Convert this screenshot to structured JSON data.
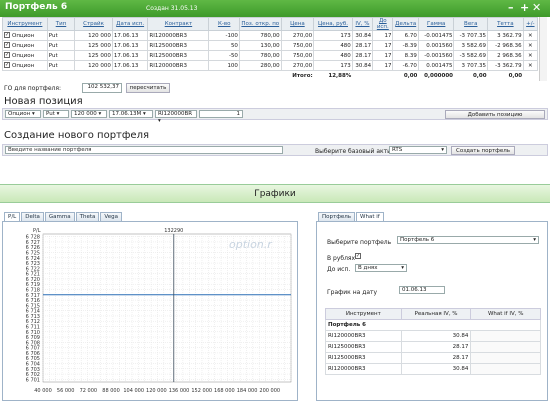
{
  "window": {
    "title": "Портфель 6",
    "created": "Создан 31.05.13"
  },
  "table": {
    "headers": [
      "Инструмент",
      "Тип",
      "Страйк",
      "Дата исп.",
      "Контракт",
      "К-во",
      "Поз. откр. по",
      "Цена",
      "Цена, руб.",
      "IV, %",
      "До исп.",
      "Дельта",
      "Гамма",
      "Вега",
      "Тетта",
      "+/-"
    ],
    "rows": [
      [
        "Опцион",
        "Put",
        "120 000",
        "17.06.13",
        "RI120000BR3",
        "-100",
        "780,00",
        "270,00",
        "173",
        "30.84",
        "17",
        "6.70",
        "-0.001475",
        "-3 707.35",
        "3 362.79"
      ],
      [
        "Опцион",
        "Put",
        "125 000",
        "17.06.13",
        "RI125000BR3",
        "50",
        "130,00",
        "750,00",
        "480",
        "28.17",
        "17",
        "-8.39",
        "0.001560",
        "3 582.69",
        "-2 968.36"
      ],
      [
        "Опцион",
        "Put",
        "125 000",
        "17.06.13",
        "RI125000BR3",
        "-50",
        "780,00",
        "750,00",
        "480",
        "28.17",
        "17",
        "8.39",
        "-0.001560",
        "-3 582.69",
        "2 968.36"
      ],
      [
        "Опцион",
        "Put",
        "120 000",
        "17.06.13",
        "RI120000BR3",
        "100",
        "280,00",
        "270,00",
        "173",
        "30.84",
        "17",
        "-6.70",
        "0.001475",
        "3 707.35",
        "-3 362.79"
      ]
    ],
    "total_label": "Итого:",
    "total_pct": "12,88%",
    "totals": [
      "0,00",
      "0,000000",
      "0,00",
      "0,00"
    ]
  },
  "go": {
    "label": "ГО для портфеля:",
    "value": "102 532,37",
    "recalc": "пересчитать"
  },
  "new_position": {
    "title": "Новая позиция",
    "instrument": "Опцион",
    "type": "Put",
    "strike": "120 000",
    "date": "17.06.13M",
    "contract": "RI120000BR",
    "qty": "1",
    "add_button": "Добавить позицию"
  },
  "new_portfolio": {
    "title": "Создание нового портфеля",
    "name_placeholder": "Введите название портфеля",
    "base_label": "Выберите базовый актив",
    "base_value": "RTS",
    "create_button": "Создать портфель"
  },
  "charts_title": "Графики",
  "chart_tabs": [
    "P/L",
    "Delta",
    "Gamma",
    "Theta",
    "Vega"
  ],
  "right_tabs": [
    "Портфель",
    "What if"
  ],
  "right": {
    "portfolio_label": "Выберите портфель",
    "portfolio_value": "Портфель 6",
    "rub_label": "В рублях",
    "expiry_label": "До исп.",
    "expiry_value": "В днях",
    "date_label": "График на дату",
    "date_value": "01.06.13",
    "iv_headers": [
      "Инструмент",
      "Реальная IV, %",
      "What if IV, %"
    ],
    "group": "Портфель 6",
    "iv_rows": [
      [
        "RI120000BR3",
        "30.84"
      ],
      [
        "RI125000BR3",
        "28.17"
      ],
      [
        "RI125000BR3",
        "28.17"
      ],
      [
        "RI120000BR3",
        "30.84"
      ]
    ]
  },
  "chart_data": {
    "type": "line",
    "ylabel": "P/L",
    "crosshair_label": "132290",
    "watermark": "option.r",
    "x_ticks": [
      "40 000",
      "56 000",
      "72 000",
      "88 000",
      "104 000",
      "120 000",
      "136 000",
      "152 000",
      "168 000",
      "184 000",
      "200 000"
    ],
    "y_ticks": [
      "6 728",
      "6 727",
      "6 726",
      "6 725",
      "6 724",
      "6 723",
      "6 722",
      "6 721",
      "6 720",
      "6 719",
      "6 718",
      "6 717",
      "6 716",
      "6 715",
      "6 714",
      "6 713",
      "6 712",
      "6 711",
      "6 710",
      "6 709",
      "6 708",
      "6 707",
      "6 706",
      "6 705",
      "6 704",
      "6 703",
      "6 702",
      "6 701"
    ],
    "xlim": [
      40000,
      215000
    ],
    "ylim": [
      6700.5,
      6728.5
    ],
    "series": [
      {
        "x": [
          40000,
          215000
        ],
        "values": [
          6717,
          6717
        ]
      }
    ],
    "crosshair_x": 132290,
    "colors": {
      "line": "#2a6fb5",
      "crosshair": "#3a4a5a"
    }
  }
}
